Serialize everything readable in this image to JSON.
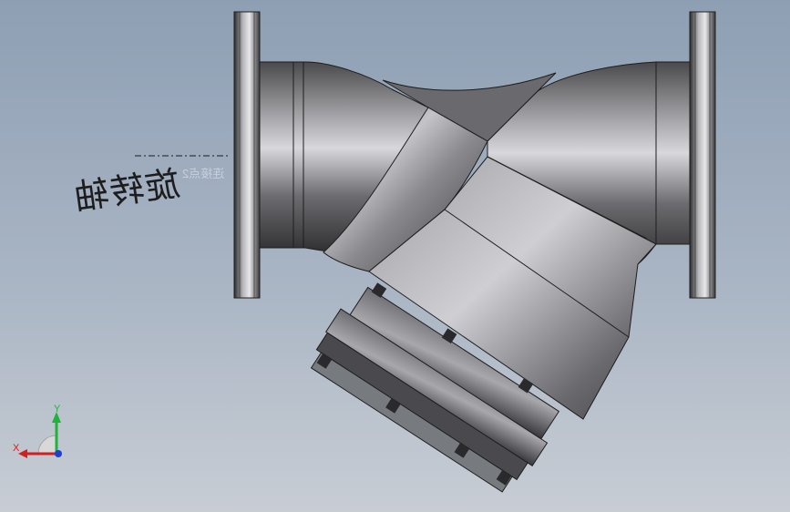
{
  "viewport": {
    "background_top": "#8e9fb4",
    "background_bottom": "#c8cdd4"
  },
  "model": {
    "name": "y-strainer-valve",
    "rotation_axis_label": "旋转轴",
    "connection_point_label": "连接点2"
  },
  "triad": {
    "x_label": "X",
    "y_label": "Y",
    "x_color": "#d21f1f",
    "y_color": "#1fb33a",
    "z_color": "#1f3fd2"
  }
}
